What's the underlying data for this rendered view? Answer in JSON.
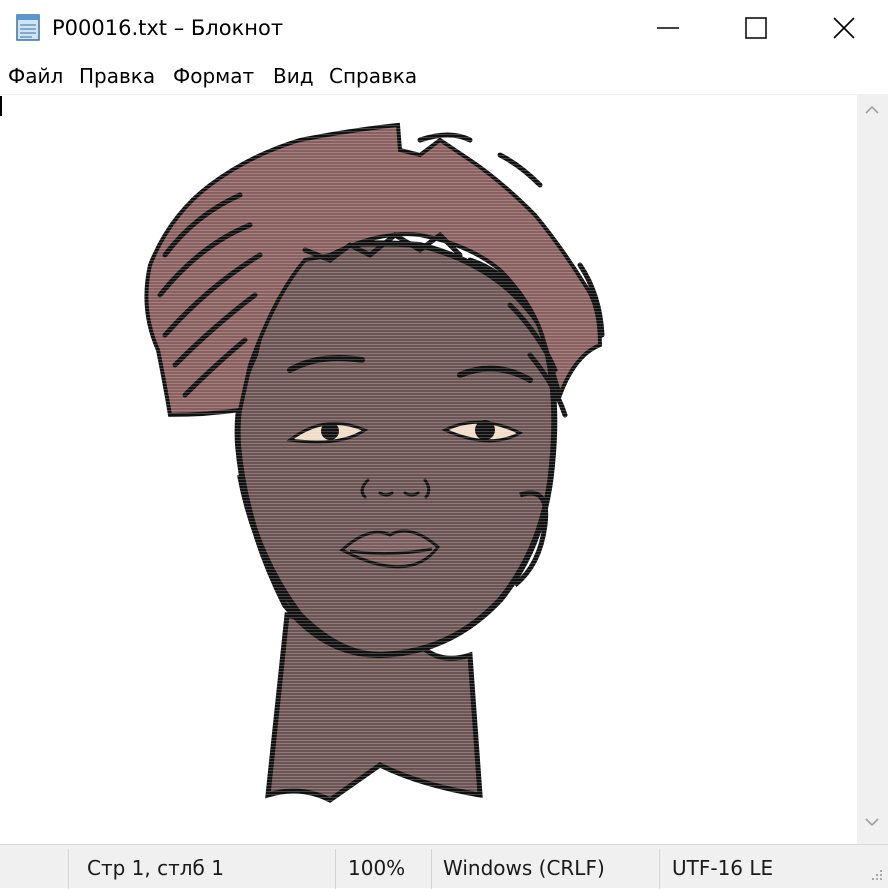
{
  "window": {
    "title": "P00016.txt – Блокнот"
  },
  "menu": {
    "file": "Файл",
    "edit": "Правка",
    "format": "Формат",
    "view": "Вид",
    "help": "Справка"
  },
  "status": {
    "position": "Стр 1, стлб 1",
    "zoom": "100%",
    "line_endings": "Windows (CRLF)",
    "encoding": "UTF-16 LE"
  },
  "icons": {
    "app": "notepad-icon",
    "minimize": "minimize-icon",
    "maximize": "maximize-icon",
    "close": "close-icon",
    "scroll_up": "chevron-up-icon",
    "scroll_down": "chevron-down-icon",
    "grip": "resize-grip-icon"
  },
  "colors": {
    "hair": "#8a5f5f",
    "skin": "#6d5454",
    "outline": "#111111",
    "highlight": "#f0dcc8",
    "chrome": "#f0f0f0"
  }
}
